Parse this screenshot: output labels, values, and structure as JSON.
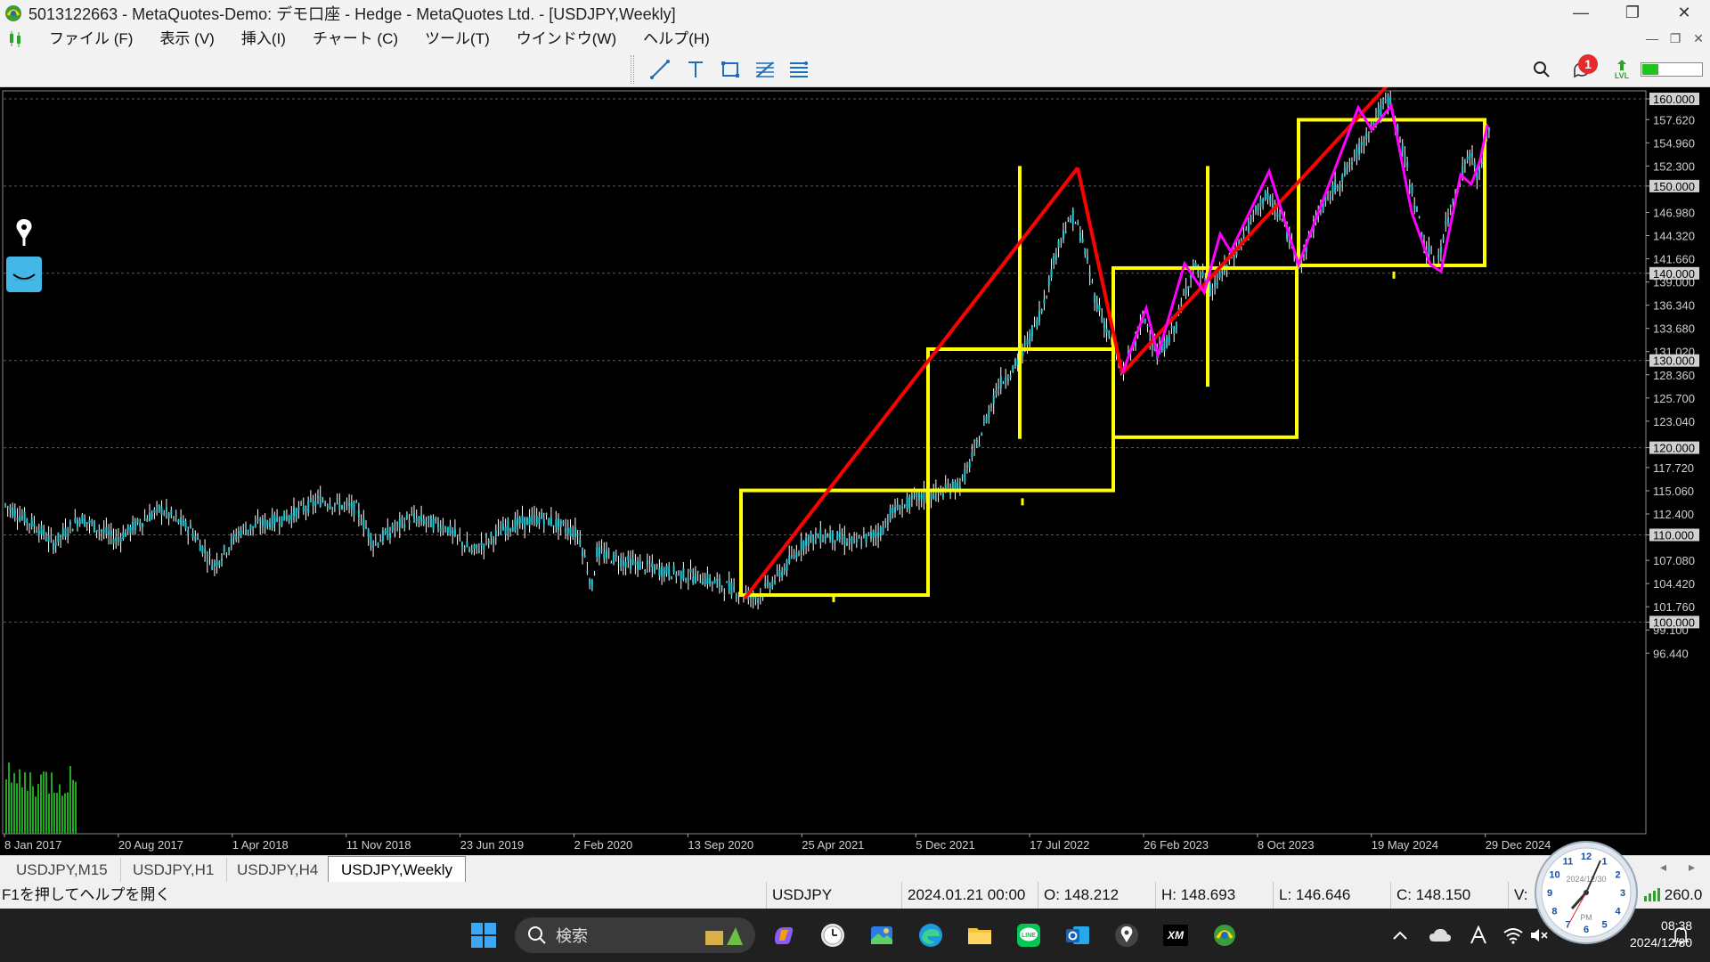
{
  "window": {
    "title": "5013122663 - MetaQuotes-Demo: デモ口座 - Hedge - MetaQuotes Ltd. - [USDJPY,Weekly]",
    "minimize": "—",
    "maximize": "❐",
    "close": "✕"
  },
  "menu": {
    "items": [
      {
        "label": "ファイル (F)"
      },
      {
        "label": "表示 (V)"
      },
      {
        "label": "挿入(I)"
      },
      {
        "label": "チャート (C)"
      },
      {
        "label": "ツール(T)"
      },
      {
        "label": "ウインドウ(W)"
      },
      {
        "label": "ヘルプ(H)"
      }
    ],
    "child_controls": [
      "—",
      "❐",
      "✕"
    ]
  },
  "toolbar": {
    "tools": [
      "trendline-icon",
      "text-icon",
      "rectangle-icon",
      "fibonacci-icon",
      "channel-icon"
    ],
    "notification_count": "1",
    "lvl_label": "LVL",
    "signal_strength": 0.28
  },
  "chart": {
    "symbol": "USDJPY",
    "timeframe": "Weekly",
    "background": "#000000",
    "candle_color": "#1ec8d6",
    "wick_color": "#ffffff",
    "price_axis": [
      "160.000",
      "157.620",
      "154.960",
      "152.300",
      "150.000",
      "146.980",
      "144.320",
      "141.660",
      "140.000",
      "139.000",
      "136.340",
      "133.680",
      "131.020",
      "130.000",
      "128.360",
      "125.700",
      "123.040",
      "120.000",
      "117.720",
      "115.060",
      "112.400",
      "110.000",
      "107.080",
      "104.420",
      "101.760",
      "100.000",
      "99.100",
      "96.440"
    ],
    "highlighted_levels": [
      "160.000",
      "150.000",
      "140.000",
      "130.000",
      "120.000",
      "110.000",
      "100.000"
    ],
    "time_axis": [
      "8 Jan 2017",
      "20 Aug 2017",
      "1 Apr 2018",
      "11 Nov 2018",
      "23 Jun 2019",
      "2 Feb 2020",
      "13 Sep 2020",
      "25 Apr 2021",
      "5 Dec 2021",
      "17 Jul 2022",
      "26 Feb 2023",
      "8 Oct 2023",
      "19 May 2024",
      "29 Dec 2024"
    ],
    "drawing_colors": {
      "box": "#ffff00",
      "trend": "#ff0000",
      "zigzag": "#ff00ff",
      "grid": "#5a5a5a",
      "volume": "#1fa81f"
    }
  },
  "tabs": [
    {
      "label": "USDJPY,M15",
      "active": false
    },
    {
      "label": "USDJPY,H1",
      "active": false
    },
    {
      "label": "USDJPY,H4",
      "active": false
    },
    {
      "label": "USDJPY,Weekly",
      "active": true
    }
  ],
  "status": {
    "help": "F1を押してヘルプを開く",
    "symbol": "USDJPY",
    "datetime": "2024.01.21 00:00",
    "open": "O: 148.212",
    "high": "H: 148.693",
    "low": "L: 146.646",
    "close": "C: 148.150",
    "volume": "V:",
    "ping": "260.0"
  },
  "taskbar": {
    "search_placeholder": "検索",
    "time": "08:38",
    "date": "2024/12/30",
    "apps": [
      "start-icon",
      "copilot-icon",
      "clock-app-icon",
      "photos-icon",
      "edge-icon",
      "explorer-icon",
      "line-icon",
      "outlook-icon",
      "metaeditor-icon",
      "xm-icon",
      "metatrader-icon"
    ],
    "clock_date": "2024/12/30",
    "clock_ampm": "PM"
  }
}
